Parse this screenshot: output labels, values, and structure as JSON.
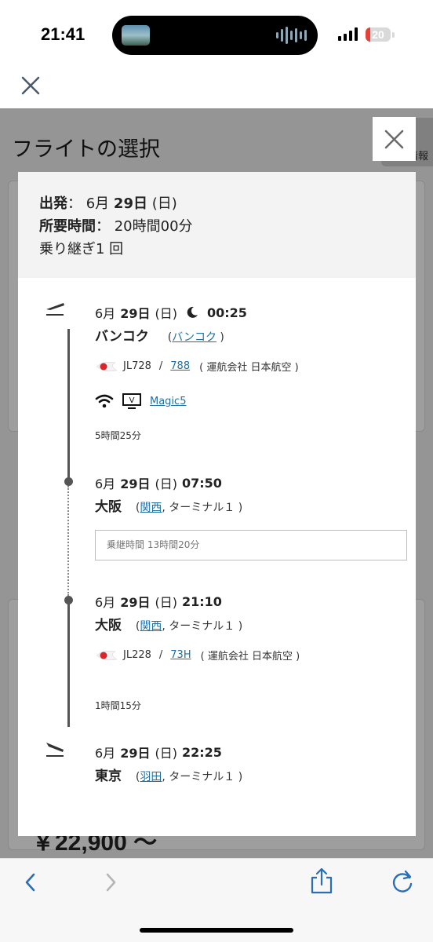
{
  "status_bar": {
    "time": "21:41",
    "battery": "20",
    "battery_level": 0.2
  },
  "underlying_page": {
    "title": "フライトの選択",
    "side_tab_label": "情報",
    "price": "￥22,900 ～"
  },
  "summary": {
    "departure_label": "出発",
    "departure_sep": "：",
    "departure_date_prefix": "6月",
    "departure_day": "29日",
    "departure_weekday": "(日)",
    "duration_label": "所要時間",
    "duration_sep": "：",
    "duration_value": "20時間00分",
    "transfers": "乗り継ぎ1 回"
  },
  "itinerary": {
    "dep": {
      "date_prefix": "6月",
      "day": "29日",
      "weekday": "(日)",
      "time": "00:25",
      "city": "バンコク",
      "paren_open": "(",
      "airport": "バンコク",
      "paren_close": ")"
    },
    "seg1": {
      "flight": "JL728",
      "sep": "/",
      "aircraft": "788",
      "operator": "( 運航会社 日本航空 )",
      "entertainment": "Magic5",
      "duration": "5時間25分"
    },
    "arr1": {
      "date_prefix": "6月",
      "day": "29日",
      "weekday": "(日)",
      "time": "07:50",
      "city": "大阪",
      "paren_open": "(",
      "airport": "関西",
      "terminal": ", ターミナル１ )"
    },
    "transit": "乗継時間 13時間20分",
    "dep2": {
      "date_prefix": "6月",
      "day": "29日",
      "weekday": "(日)",
      "time": "21:10",
      "city": "大阪",
      "paren_open": "(",
      "airport": "関西",
      "terminal": ", ターミナル１ )"
    },
    "seg2": {
      "flight": "JL228",
      "sep": "/",
      "aircraft": "73H",
      "operator": "( 運航会社 日本航空 )",
      "duration": "1時間15分"
    },
    "arr2": {
      "date_prefix": "6月",
      "day": "29日",
      "weekday": "(日)",
      "time": "22:25",
      "city": "東京",
      "paren_open": "(",
      "airport": "羽田",
      "terminal": ", ターミナル１ )"
    }
  },
  "colors": {
    "accent_link": "#1f6fa3",
    "airline_red": "#d9242b",
    "battery_red": "#e5413a"
  }
}
